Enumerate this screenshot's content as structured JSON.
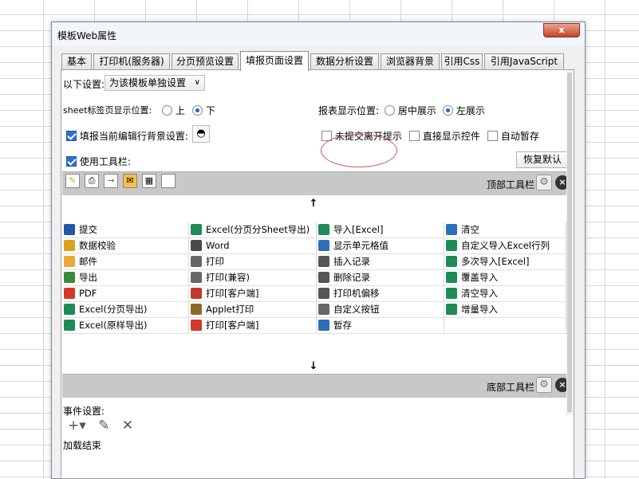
{
  "dialog": {
    "title": "模板Web属性",
    "close_label": "x"
  },
  "tabs": [
    {
      "label": "基本"
    },
    {
      "label": "打印机(服务器)"
    },
    {
      "label": "分页预览设置"
    },
    {
      "label": "填报页面设置",
      "active": true
    },
    {
      "label": "数据分析设置"
    },
    {
      "label": "浏览器背景"
    },
    {
      "label": "引用Css"
    },
    {
      "label": "引用JavaScript"
    }
  ],
  "settings": {
    "scope_label": "以下设置:",
    "scope_value": "为该模板单独设置",
    "sheet_pos_label": "sheet标签页显示位置:",
    "sheet_pos_options": [
      "上",
      "下"
    ],
    "sheet_pos_selected": "下",
    "report_pos_label": "报表显示位置:",
    "report_pos_options": [
      "居中展示",
      "左展示"
    ],
    "report_pos_selected": "左展示",
    "bg_checkbox_label": "填报当前编辑行背景设置:",
    "unsubmitted_label": "未提交离开提示",
    "direct_show_label": "直接显示控件",
    "autosave_label": "自动暂存",
    "use_toolbar_label": "使用工具栏:",
    "restore_default": "恢复默认"
  },
  "toolbar": {
    "top_label": "顶部工具栏",
    "bottom_label": "底部工具栏",
    "top_icons": [
      "edit-icon",
      "print-icon",
      "export-icon",
      "mail-icon",
      "insert-icon",
      "blank-icon"
    ]
  },
  "grid_items": [
    [
      "提交",
      "Excel(分页分Sheet导出)",
      "导入[Excel]",
      "清空"
    ],
    [
      "数据校验",
      "Word",
      "显示单元格值",
      "自定义导入Excel行列"
    ],
    [
      "邮件",
      "打印",
      "插入记录",
      "多次导入[Excel]"
    ],
    [
      "导出",
      "打印(兼容)",
      "删除记录",
      "覆盖导入"
    ],
    [
      "PDF",
      "打印[客户端]",
      "打印机偏移",
      "清空导入"
    ],
    [
      "Excel(分页导出)",
      "Applet打印",
      "自定义按钮",
      "增量导入"
    ],
    [
      "Excel(原样导出)",
      "打印[客户端]",
      "暂存",
      ""
    ]
  ],
  "grid_icon_colors": [
    [
      "#2457a8",
      "#1f8a5a",
      "#1f8a5a",
      "#2a6fb8"
    ],
    [
      "#d9a21c",
      "#4a4a4a",
      "#2a6fb8",
      "#1f8a5a"
    ],
    [
      "#e8a93a",
      "#666666",
      "#555555",
      "#1f8a5a"
    ],
    [
      "#3a8a3a",
      "#666666",
      "#555555",
      "#1f8a5a"
    ],
    [
      "#d03a2a",
      "#c0392b",
      "#555555",
      "#1f8a5a"
    ],
    [
      "#1f8a5a",
      "#8a6a2a",
      "#666666",
      "#1f8a5a"
    ],
    [
      "#1f8a5a",
      "#d03a2a",
      "#2a6fb8",
      ""
    ]
  ],
  "events": {
    "label": "事件设置:",
    "status": "加载结束"
  }
}
